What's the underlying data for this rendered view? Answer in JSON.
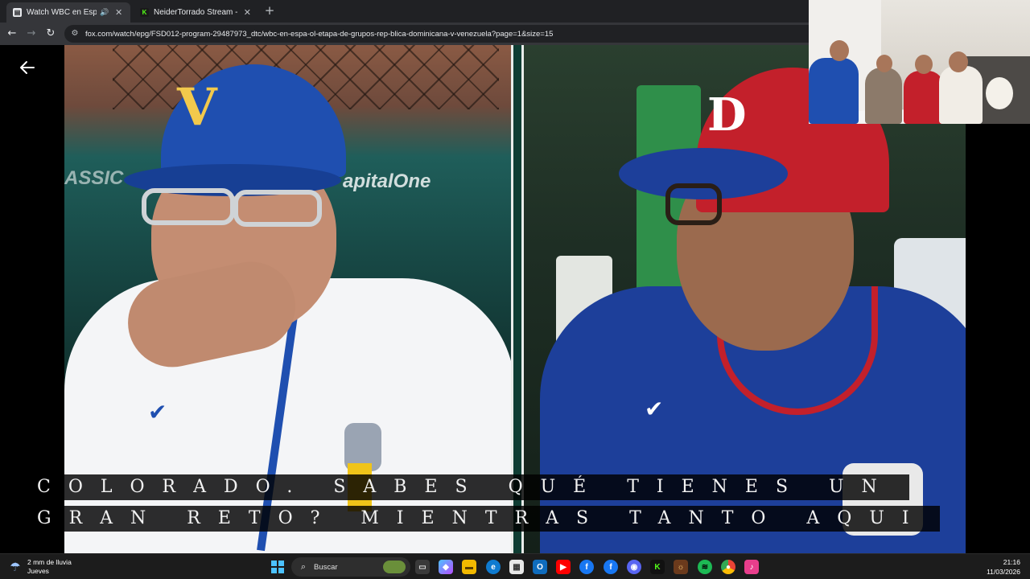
{
  "browser": {
    "tabs": [
      {
        "title": "Watch WBC en Español - Et",
        "favicon": "page-icon",
        "active": true,
        "audio": true
      },
      {
        "title": "NeiderTorrado Stream - Watch",
        "favicon": "kick-icon",
        "active": false,
        "audio": false
      }
    ],
    "url": "fox.com/watch/epg/FSD012-program-29487973_dtc/wbc-en-espa-ol-etapa-de-grupos-rep-blica-dominicana-v-venezuela?page=1&size=15"
  },
  "video": {
    "stadium_banner": "ASSIC",
    "sponsor": "apitalOne",
    "left_cap_logo": "V",
    "right_cap_logo": "D"
  },
  "captions": {
    "line1": "COLORADO. SABES QUÉ TIENES UN",
    "line2": "GRAN RETO? MIENTRAS TANTO AQUI"
  },
  "taskbar": {
    "weather_main": "2 mm de lluvia",
    "weather_sub": "Jueves",
    "search_placeholder": "Buscar",
    "time": "21:16",
    "date": "11/03/2026"
  },
  "colors": {
    "venezuela_blue": "#1f4fb0",
    "dominican_red": "#c3202b",
    "dominican_blue": "#1d3f9a",
    "taskbar": "#1c1c1c"
  }
}
